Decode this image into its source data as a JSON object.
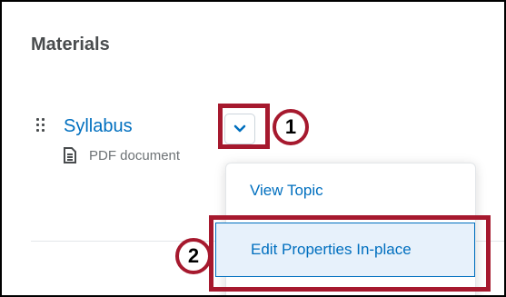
{
  "section": {
    "title": "Materials"
  },
  "topic": {
    "name": "Syllabus",
    "type": "PDF document"
  },
  "menu": {
    "items": [
      {
        "label": "View Topic"
      },
      {
        "label": "Edit Properties In-place"
      }
    ]
  },
  "callouts": [
    "1",
    "2"
  ],
  "colors": {
    "link": "#006fbf",
    "highlight": "#a6192e",
    "selected_item_bg": "#e7f1fb"
  },
  "icons": {
    "drag": "drag-handle-icon",
    "document": "document-icon",
    "caret": "chevron-down-icon"
  }
}
